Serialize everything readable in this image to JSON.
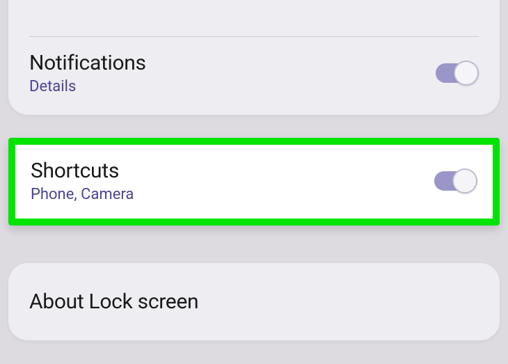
{
  "settings": {
    "notifications": {
      "title": "Notifications",
      "subtitle": "Details",
      "enabled": true
    },
    "shortcuts": {
      "title": "Shortcuts",
      "subtitle": "Phone, Camera",
      "enabled": true,
      "highlighted": true
    },
    "about": {
      "title": "About Lock screen"
    }
  },
  "colors": {
    "highlight_border": "#00e400",
    "link_text": "#4b4494",
    "card_bg": "#eeedf1",
    "page_bg": "#dddbe0"
  }
}
